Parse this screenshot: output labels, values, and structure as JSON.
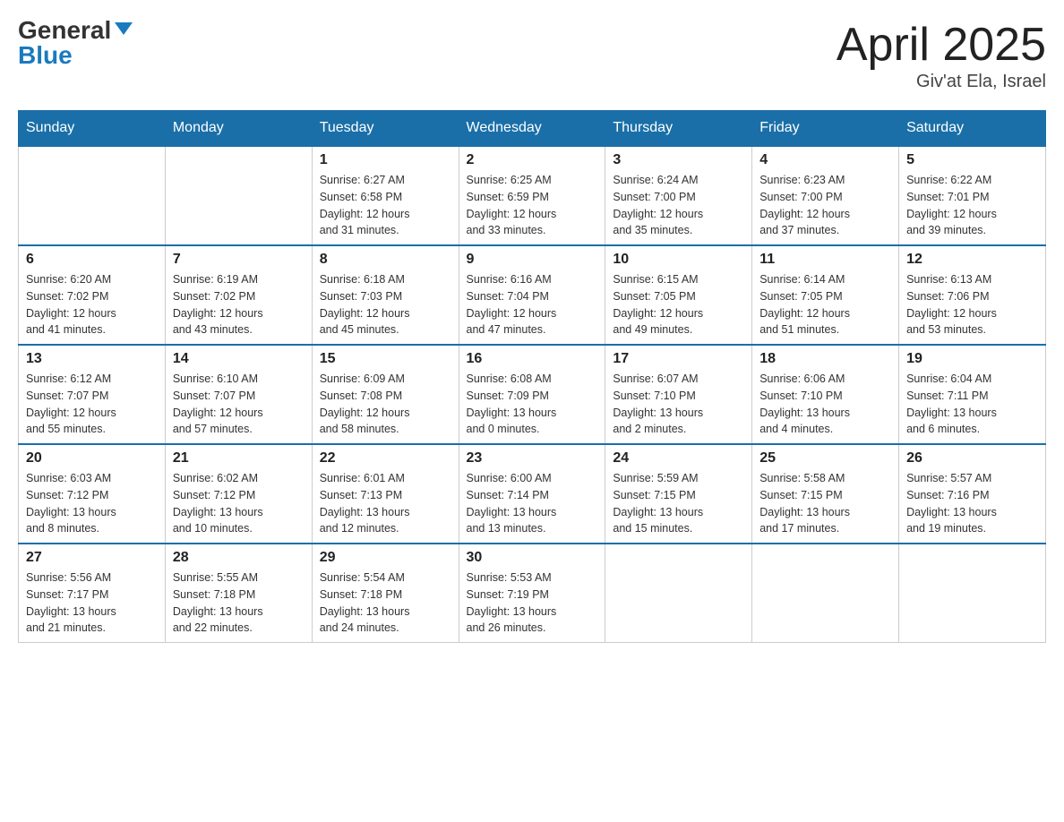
{
  "header": {
    "logo_general": "General",
    "logo_blue": "Blue",
    "title": "April 2025",
    "location": "Giv'at Ela, Israel"
  },
  "weekdays": [
    "Sunday",
    "Monday",
    "Tuesday",
    "Wednesday",
    "Thursday",
    "Friday",
    "Saturday"
  ],
  "weeks": [
    [
      {
        "day": "",
        "info": ""
      },
      {
        "day": "",
        "info": ""
      },
      {
        "day": "1",
        "info": "Sunrise: 6:27 AM\nSunset: 6:58 PM\nDaylight: 12 hours\nand 31 minutes."
      },
      {
        "day": "2",
        "info": "Sunrise: 6:25 AM\nSunset: 6:59 PM\nDaylight: 12 hours\nand 33 minutes."
      },
      {
        "day": "3",
        "info": "Sunrise: 6:24 AM\nSunset: 7:00 PM\nDaylight: 12 hours\nand 35 minutes."
      },
      {
        "day": "4",
        "info": "Sunrise: 6:23 AM\nSunset: 7:00 PM\nDaylight: 12 hours\nand 37 minutes."
      },
      {
        "day": "5",
        "info": "Sunrise: 6:22 AM\nSunset: 7:01 PM\nDaylight: 12 hours\nand 39 minutes."
      }
    ],
    [
      {
        "day": "6",
        "info": "Sunrise: 6:20 AM\nSunset: 7:02 PM\nDaylight: 12 hours\nand 41 minutes."
      },
      {
        "day": "7",
        "info": "Sunrise: 6:19 AM\nSunset: 7:02 PM\nDaylight: 12 hours\nand 43 minutes."
      },
      {
        "day": "8",
        "info": "Sunrise: 6:18 AM\nSunset: 7:03 PM\nDaylight: 12 hours\nand 45 minutes."
      },
      {
        "day": "9",
        "info": "Sunrise: 6:16 AM\nSunset: 7:04 PM\nDaylight: 12 hours\nand 47 minutes."
      },
      {
        "day": "10",
        "info": "Sunrise: 6:15 AM\nSunset: 7:05 PM\nDaylight: 12 hours\nand 49 minutes."
      },
      {
        "day": "11",
        "info": "Sunrise: 6:14 AM\nSunset: 7:05 PM\nDaylight: 12 hours\nand 51 minutes."
      },
      {
        "day": "12",
        "info": "Sunrise: 6:13 AM\nSunset: 7:06 PM\nDaylight: 12 hours\nand 53 minutes."
      }
    ],
    [
      {
        "day": "13",
        "info": "Sunrise: 6:12 AM\nSunset: 7:07 PM\nDaylight: 12 hours\nand 55 minutes."
      },
      {
        "day": "14",
        "info": "Sunrise: 6:10 AM\nSunset: 7:07 PM\nDaylight: 12 hours\nand 57 minutes."
      },
      {
        "day": "15",
        "info": "Sunrise: 6:09 AM\nSunset: 7:08 PM\nDaylight: 12 hours\nand 58 minutes."
      },
      {
        "day": "16",
        "info": "Sunrise: 6:08 AM\nSunset: 7:09 PM\nDaylight: 13 hours\nand 0 minutes."
      },
      {
        "day": "17",
        "info": "Sunrise: 6:07 AM\nSunset: 7:10 PM\nDaylight: 13 hours\nand 2 minutes."
      },
      {
        "day": "18",
        "info": "Sunrise: 6:06 AM\nSunset: 7:10 PM\nDaylight: 13 hours\nand 4 minutes."
      },
      {
        "day": "19",
        "info": "Sunrise: 6:04 AM\nSunset: 7:11 PM\nDaylight: 13 hours\nand 6 minutes."
      }
    ],
    [
      {
        "day": "20",
        "info": "Sunrise: 6:03 AM\nSunset: 7:12 PM\nDaylight: 13 hours\nand 8 minutes."
      },
      {
        "day": "21",
        "info": "Sunrise: 6:02 AM\nSunset: 7:12 PM\nDaylight: 13 hours\nand 10 minutes."
      },
      {
        "day": "22",
        "info": "Sunrise: 6:01 AM\nSunset: 7:13 PM\nDaylight: 13 hours\nand 12 minutes."
      },
      {
        "day": "23",
        "info": "Sunrise: 6:00 AM\nSunset: 7:14 PM\nDaylight: 13 hours\nand 13 minutes."
      },
      {
        "day": "24",
        "info": "Sunrise: 5:59 AM\nSunset: 7:15 PM\nDaylight: 13 hours\nand 15 minutes."
      },
      {
        "day": "25",
        "info": "Sunrise: 5:58 AM\nSunset: 7:15 PM\nDaylight: 13 hours\nand 17 minutes."
      },
      {
        "day": "26",
        "info": "Sunrise: 5:57 AM\nSunset: 7:16 PM\nDaylight: 13 hours\nand 19 minutes."
      }
    ],
    [
      {
        "day": "27",
        "info": "Sunrise: 5:56 AM\nSunset: 7:17 PM\nDaylight: 13 hours\nand 21 minutes."
      },
      {
        "day": "28",
        "info": "Sunrise: 5:55 AM\nSunset: 7:18 PM\nDaylight: 13 hours\nand 22 minutes."
      },
      {
        "day": "29",
        "info": "Sunrise: 5:54 AM\nSunset: 7:18 PM\nDaylight: 13 hours\nand 24 minutes."
      },
      {
        "day": "30",
        "info": "Sunrise: 5:53 AM\nSunset: 7:19 PM\nDaylight: 13 hours\nand 26 minutes."
      },
      {
        "day": "",
        "info": ""
      },
      {
        "day": "",
        "info": ""
      },
      {
        "day": "",
        "info": ""
      }
    ]
  ]
}
